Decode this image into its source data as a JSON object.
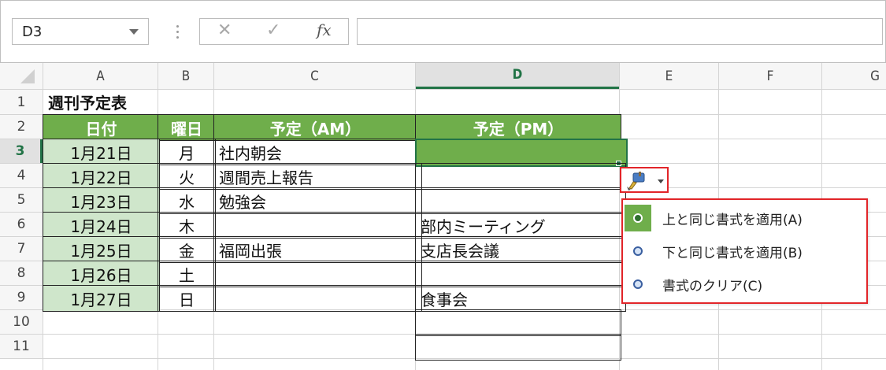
{
  "formula_bar": {
    "name_box": "D3",
    "cancel_symbol": "✕",
    "enter_symbol": "✓",
    "fx_label": "fx",
    "formula_value": ""
  },
  "columns": [
    "A",
    "B",
    "C",
    "D",
    "E",
    "F",
    "G"
  ],
  "rows": [
    "1",
    "2",
    "3",
    "4",
    "5",
    "6",
    "7",
    "8",
    "9",
    "10",
    "11"
  ],
  "sheet": {
    "title": "週刊予定表",
    "headers": [
      "日付",
      "曜日",
      "予定（AM）",
      "予定（PM）"
    ],
    "schedule": [
      {
        "date": "1月21日",
        "day": "月",
        "am": "社内朝会",
        "pm": ""
      },
      {
        "date": "1月22日",
        "day": "火",
        "am": "週間売上報告",
        "pm": ""
      },
      {
        "date": "1月23日",
        "day": "水",
        "am": "勉強会",
        "pm": ""
      },
      {
        "date": "1月24日",
        "day": "木",
        "am": "",
        "pm": "部内ミーティング"
      },
      {
        "date": "1月25日",
        "day": "金",
        "am": "福岡出張",
        "pm": "支店長会議"
      },
      {
        "date": "1月26日",
        "day": "土",
        "am": "",
        "pm": ""
      },
      {
        "date": "1月27日",
        "day": "日",
        "am": "",
        "pm": "食事会"
      }
    ]
  },
  "insert_options": {
    "button_icon": "paintbrush-icon",
    "options": [
      {
        "label": "上と同じ書式を適用(A)",
        "selected": true
      },
      {
        "label": "下と同じ書式を適用(B)",
        "selected": false
      },
      {
        "label": "書式のクリア(C)",
        "selected": false
      }
    ]
  },
  "colors": {
    "header_green": "#6fae4b",
    "date_green": "#cfe6cb",
    "highlight_red": "#e22529"
  }
}
